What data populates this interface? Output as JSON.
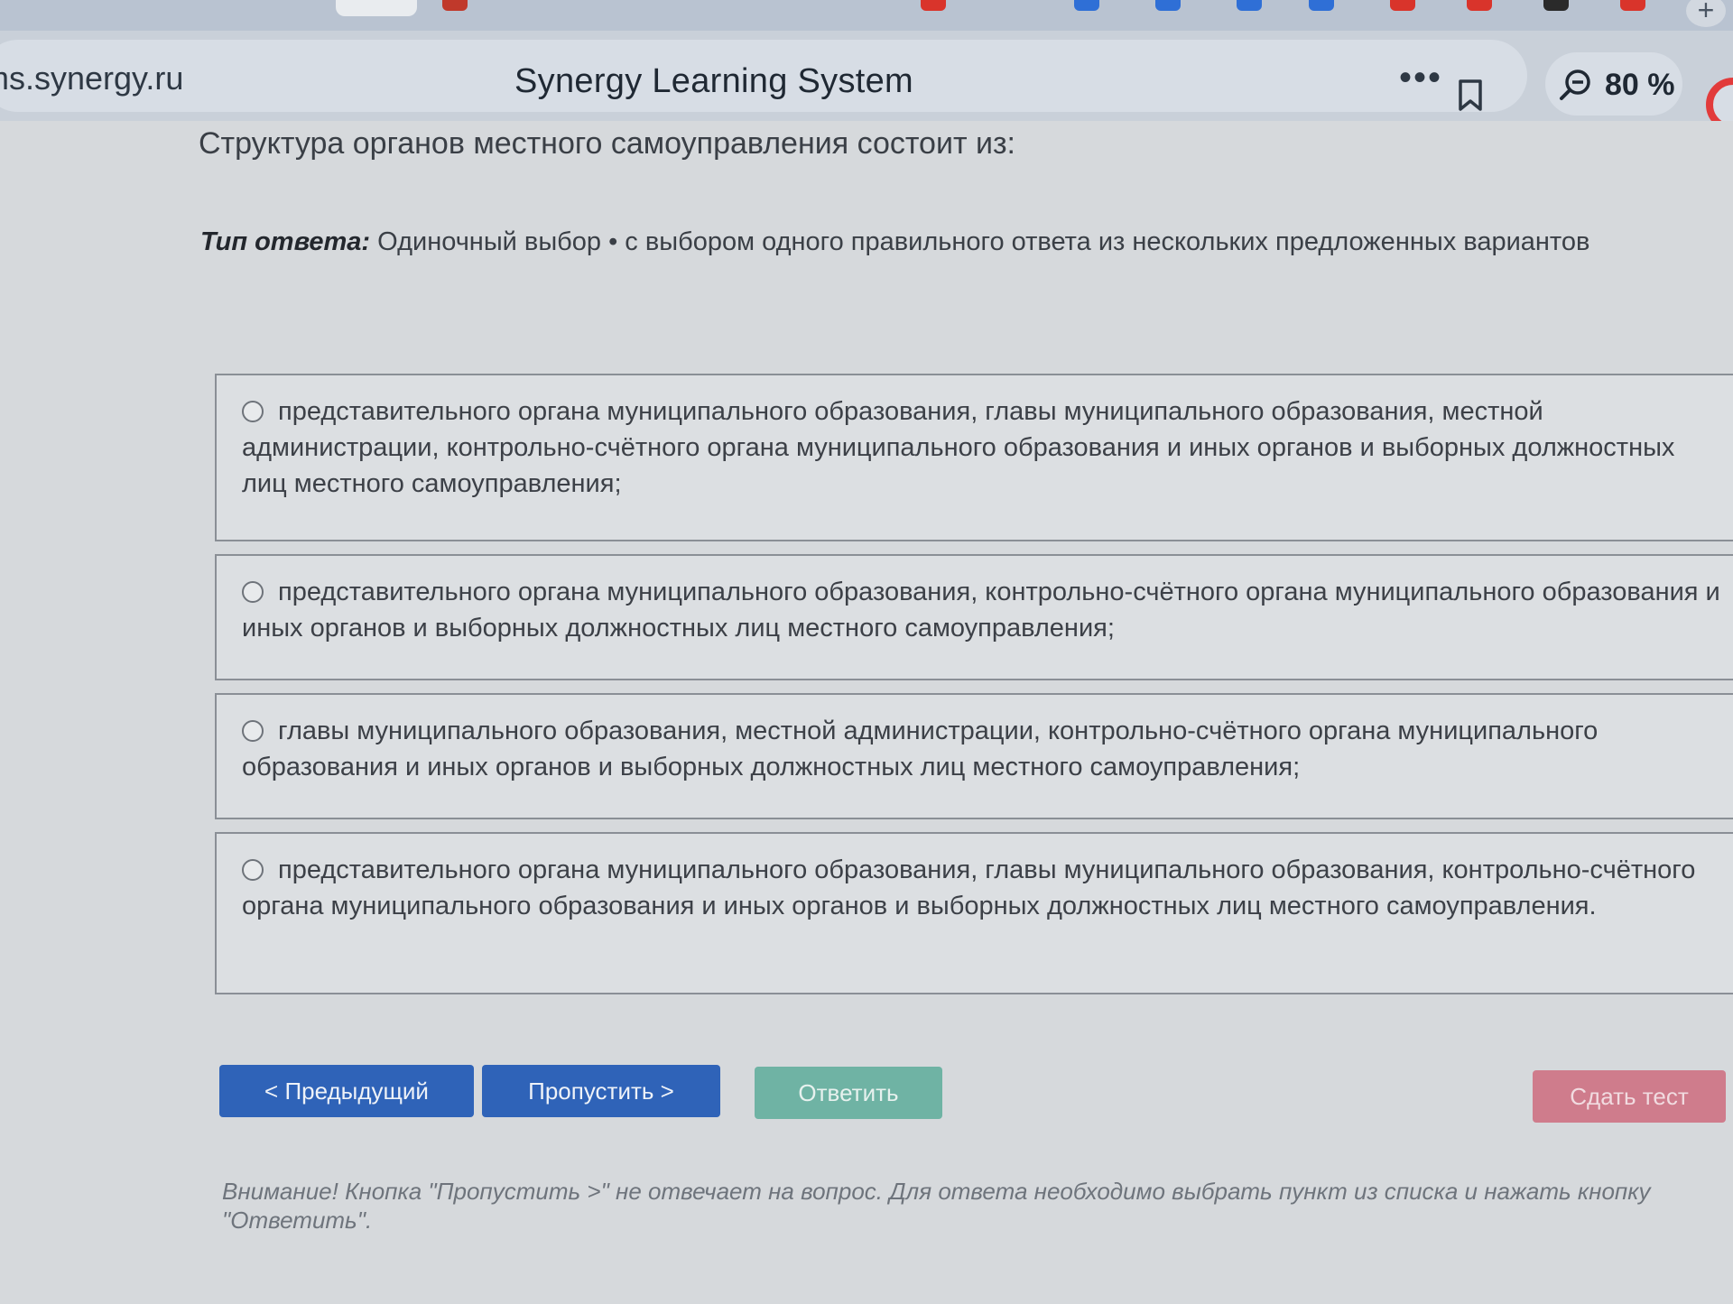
{
  "browser": {
    "url": "ms.synergy.ru",
    "page_title": "Synergy Learning System",
    "zoom": "80 %"
  },
  "quiz": {
    "question": "Структура органов местного самоуправления состоит из:",
    "answer_type_label": "Тип ответа:",
    "answer_type_value": "Одиночный выбор • с выбором одного правильного ответа из нескольких предложенных вариантов",
    "options": [
      {
        "text": "представительного органа муниципального образования, главы муниципального образования, местной администрации, контрольно-счётного органа муниципального образования и иных органов и выборных должностных лиц местного самоуправления;",
        "selected": false
      },
      {
        "text": "представительного органа муниципального образования, контрольно-счётного органа муниципального образования и иных органов и выборных должностных лиц местного самоуправления;",
        "selected": false
      },
      {
        "text": "главы муниципального образования, местной администрации, контрольно-счётного органа муниципального образования и иных органов и выборных должностных лиц местного самоуправления;",
        "selected": false
      },
      {
        "text": "представительного органа муниципального образования, главы муниципального образования, контрольно-счётного органа муниципального образования и иных органов и выборных должностных лиц местного самоуправления.",
        "selected": false
      }
    ],
    "buttons": {
      "prev": "< Предыдущий",
      "skip": "Пропустить >",
      "answer": "Ответить",
      "submit": "Сдать тест"
    },
    "notice": "Внимание! Кнопка \"Пропустить >\" не отвечает на вопрос. Для ответа необходимо выбрать пункт из списка и нажать кнопку \"Ответить\"."
  },
  "colors": {
    "primary_button": "#2f63b8",
    "answer_button": "#6fb3a4",
    "submit_button": "#cf7c8c",
    "alice_ring": "#e23b3b"
  }
}
